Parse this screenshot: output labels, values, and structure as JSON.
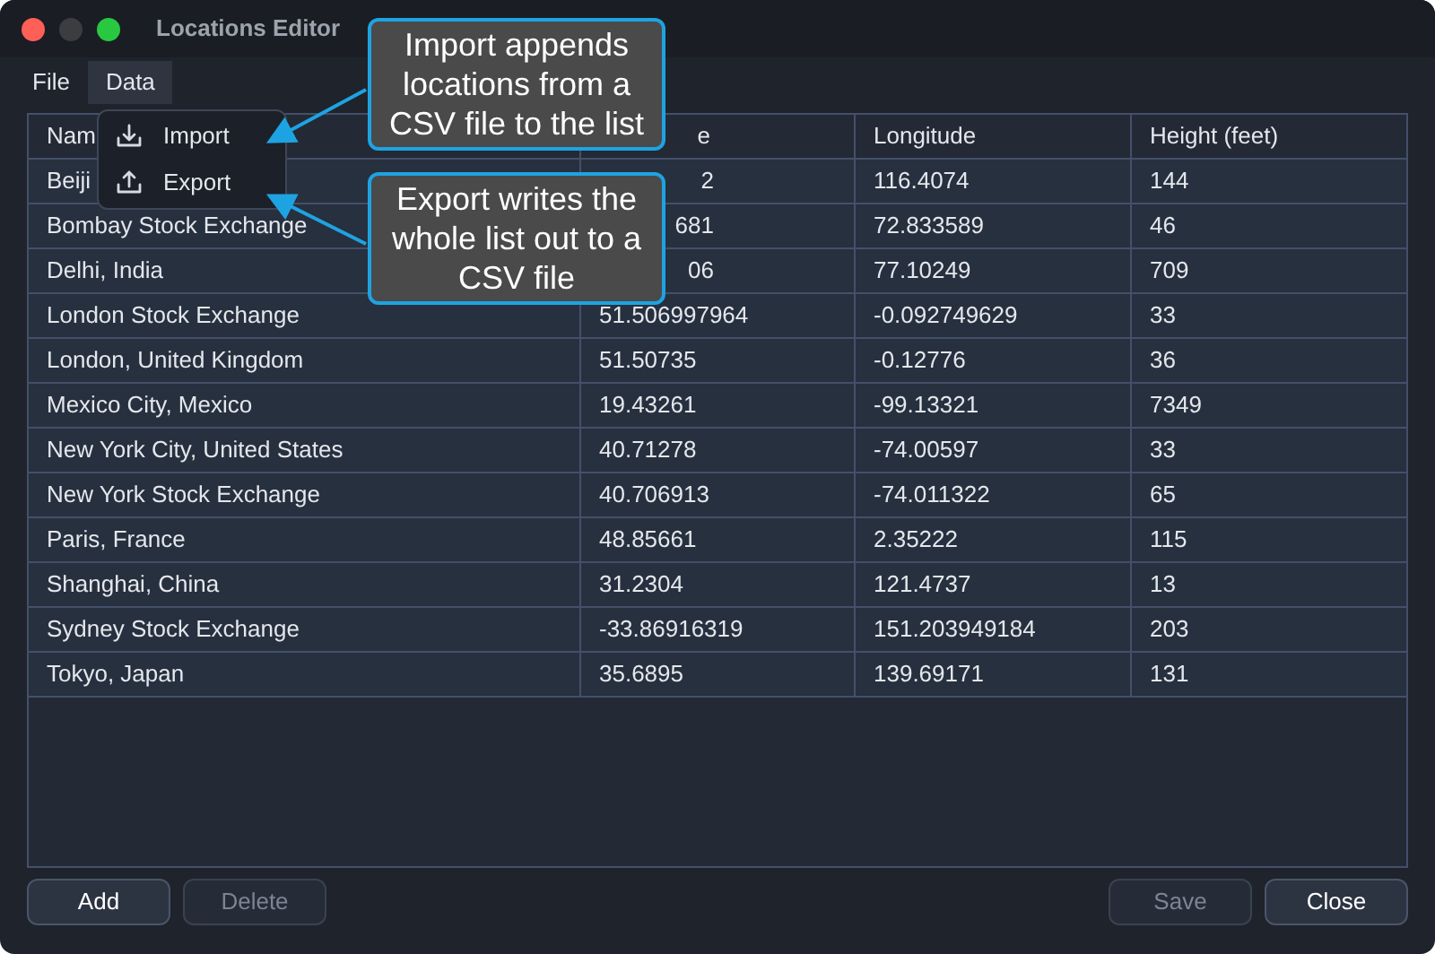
{
  "window": {
    "title": "Locations Editor"
  },
  "menubar": [
    {
      "label": "File",
      "selected": false
    },
    {
      "label": "Data",
      "selected": true
    }
  ],
  "dropdown": [
    {
      "kind": "import",
      "label": "Import"
    },
    {
      "kind": "export",
      "label": "Export"
    }
  ],
  "table": {
    "columns": [
      {
        "label": "Nam",
        "covered": false
      },
      {
        "label": "e",
        "covered": true
      },
      {
        "label": "Longitude",
        "covered": false
      },
      {
        "label": "Height (feet)",
        "covered": false
      }
    ],
    "rows": [
      [
        {
          "text": "Beiji",
          "covered": false
        },
        {
          "text": "2",
          "covered": true
        },
        {
          "text": "116.4074",
          "covered": false
        },
        {
          "text": "144",
          "covered": false
        }
      ],
      [
        {
          "text": "Bombay Stock Exchange",
          "covered": false
        },
        {
          "text": "681",
          "covered": true
        },
        {
          "text": "72.833589",
          "covered": false
        },
        {
          "text": "46",
          "covered": false
        }
      ],
      [
        {
          "text": "Delhi, India",
          "covered": false
        },
        {
          "text": "06",
          "covered": true
        },
        {
          "text": "77.10249",
          "covered": false
        },
        {
          "text": "709",
          "covered": false
        }
      ],
      [
        {
          "text": "London Stock Exchange",
          "covered": false
        },
        {
          "text": "51.506997964",
          "covered": false
        },
        {
          "text": "-0.092749629",
          "covered": false
        },
        {
          "text": "33",
          "covered": false
        }
      ],
      [
        {
          "text": "London, United Kingdom",
          "covered": false
        },
        {
          "text": "51.50735",
          "covered": false
        },
        {
          "text": "-0.12776",
          "covered": false
        },
        {
          "text": "36",
          "covered": false
        }
      ],
      [
        {
          "text": "Mexico City, Mexico",
          "covered": false
        },
        {
          "text": "19.43261",
          "covered": false
        },
        {
          "text": "-99.13321",
          "covered": false
        },
        {
          "text": "7349",
          "covered": false
        }
      ],
      [
        {
          "text": "New York City, United States",
          "covered": false
        },
        {
          "text": "40.71278",
          "covered": false
        },
        {
          "text": "-74.00597",
          "covered": false
        },
        {
          "text": "33",
          "covered": false
        }
      ],
      [
        {
          "text": "New York Stock Exchange",
          "covered": false
        },
        {
          "text": "40.706913",
          "covered": false
        },
        {
          "text": "-74.011322",
          "covered": false
        },
        {
          "text": "65",
          "covered": false
        }
      ],
      [
        {
          "text": "Paris, France",
          "covered": false
        },
        {
          "text": "48.85661",
          "covered": false
        },
        {
          "text": "2.35222",
          "covered": false
        },
        {
          "text": "115",
          "covered": false
        }
      ],
      [
        {
          "text": "Shanghai, China",
          "covered": false
        },
        {
          "text": "31.2304",
          "covered": false
        },
        {
          "text": "121.4737",
          "covered": false
        },
        {
          "text": "13",
          "covered": false
        }
      ],
      [
        {
          "text": "Sydney Stock Exchange",
          "covered": false
        },
        {
          "text": "-33.86916319",
          "covered": false
        },
        {
          "text": "151.203949184",
          "covered": false
        },
        {
          "text": "203",
          "covered": false
        }
      ],
      [
        {
          "text": "Tokyo, Japan",
          "covered": false
        },
        {
          "text": "35.6895",
          "covered": false
        },
        {
          "text": "139.69171",
          "covered": false
        },
        {
          "text": "131",
          "covered": false
        }
      ]
    ]
  },
  "buttons_left": [
    {
      "label": "Add",
      "disabled": false
    },
    {
      "label": "Delete",
      "disabled": true
    }
  ],
  "buttons_right": [
    {
      "label": "Save",
      "disabled": true
    },
    {
      "label": "Close",
      "disabled": false
    }
  ],
  "callouts": [
    "Import appends locations from a CSV file to the list",
    "Export writes the whole list out to a CSV file"
  ]
}
